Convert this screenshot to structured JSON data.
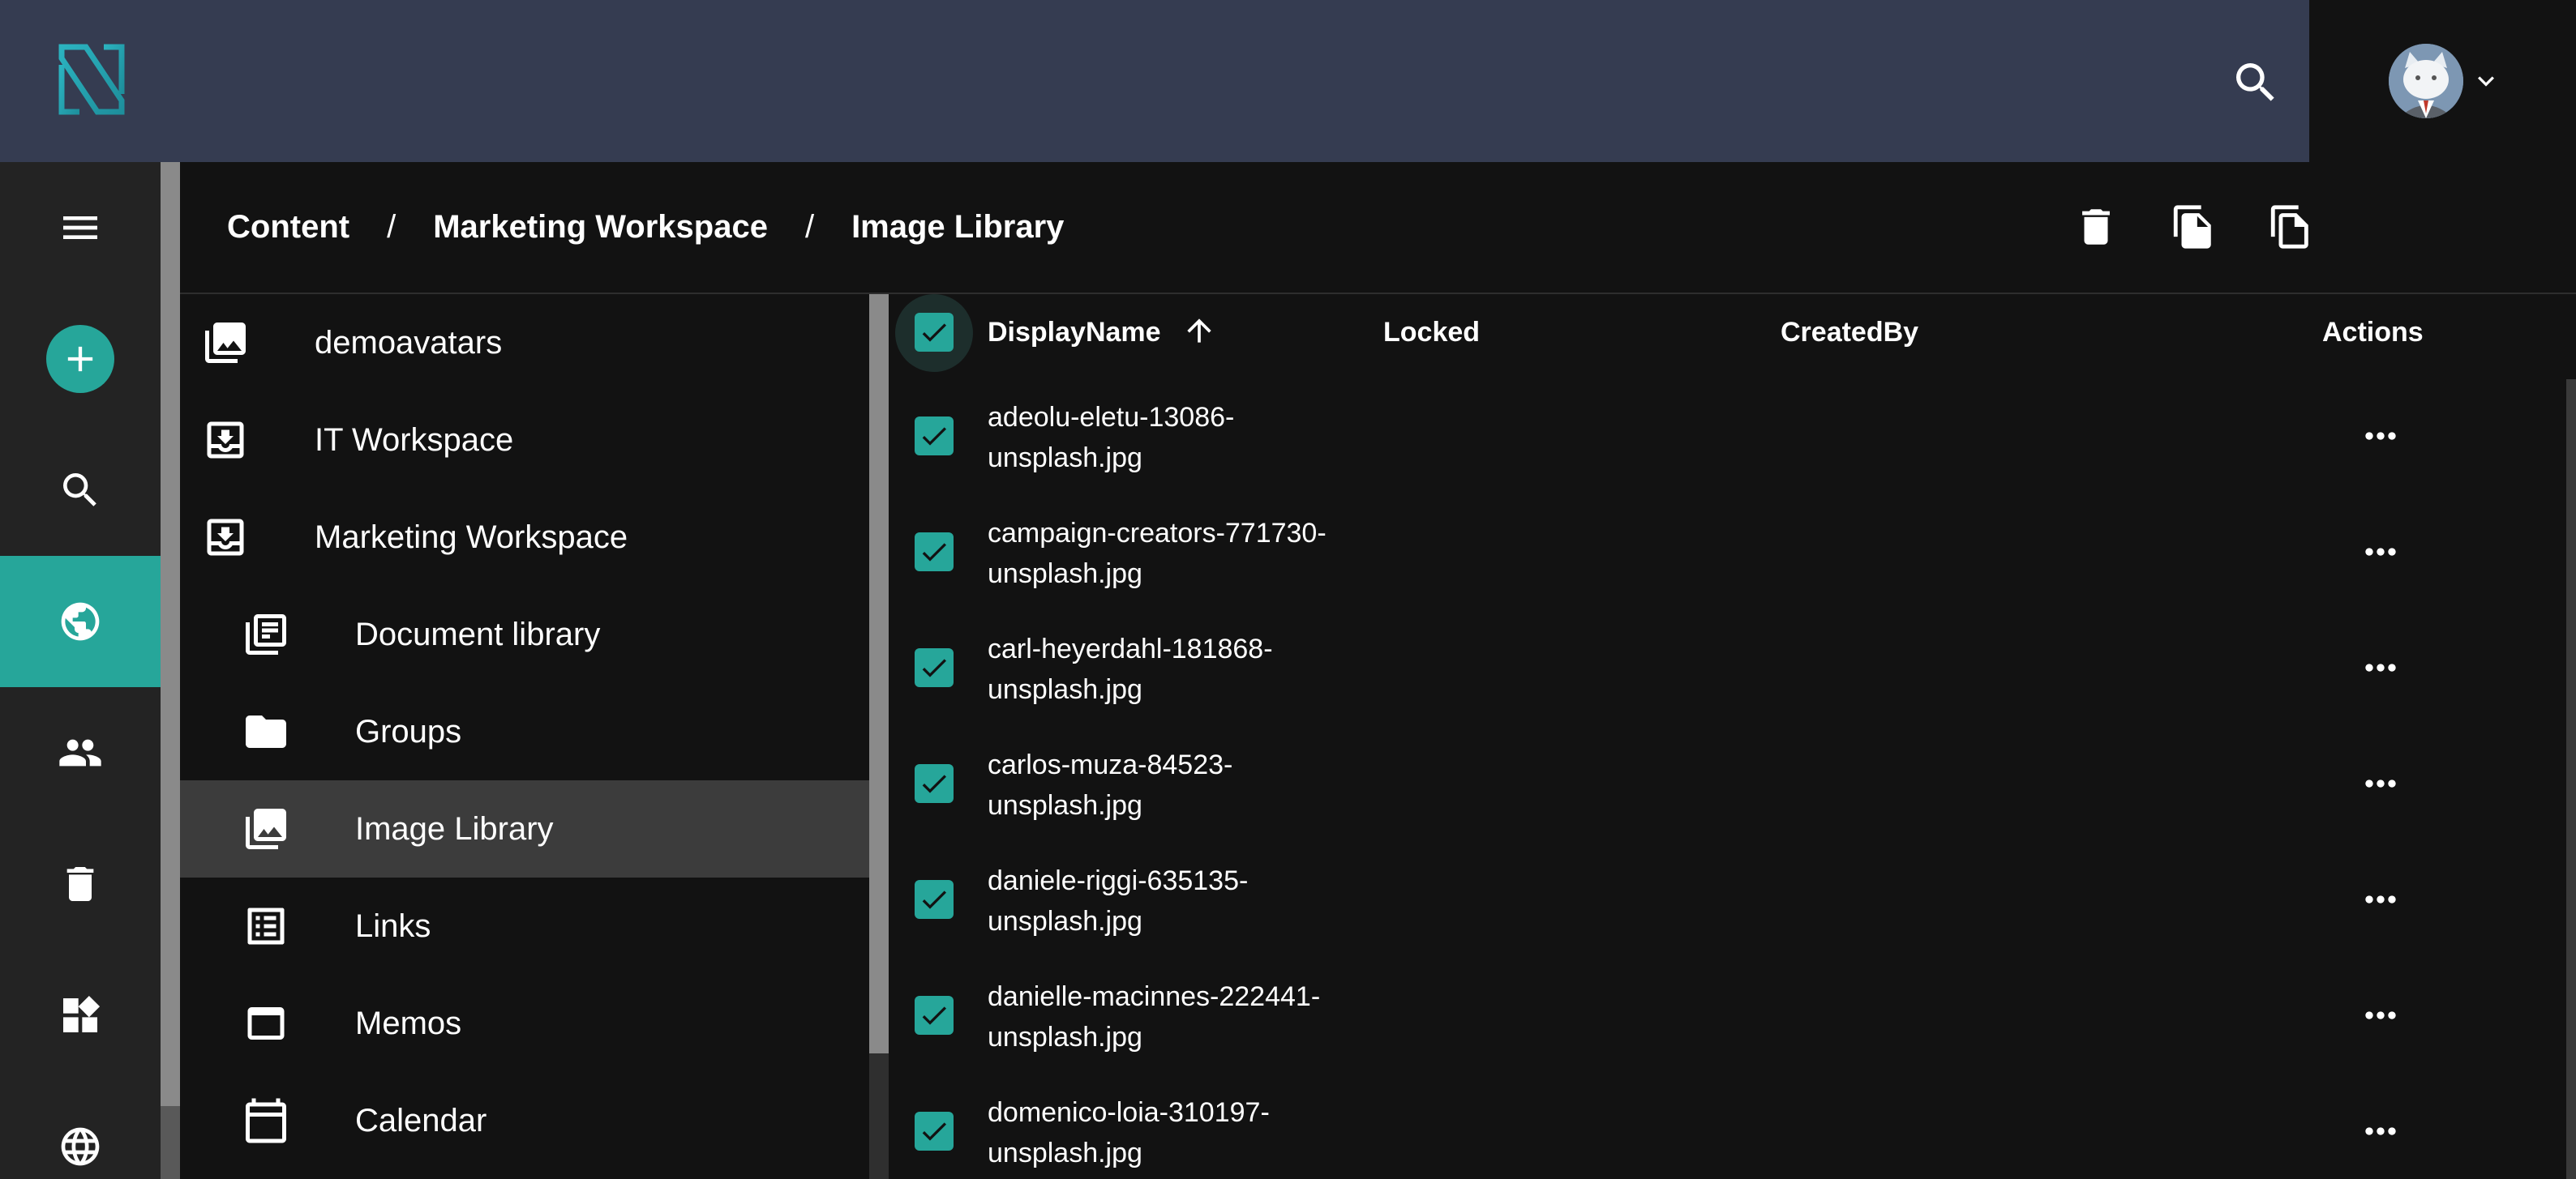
{
  "header": {
    "logo_icon": "brand-logo-icon",
    "search_icon": "search-icon",
    "avatar_icon": "user-avatar-cat",
    "menu_chevron_icon": "chevron-down-icon"
  },
  "rail": {
    "items": [
      {
        "name": "menu",
        "icon": "hamburger-menu-icon"
      },
      {
        "name": "add",
        "icon": "add-icon"
      },
      {
        "name": "search",
        "icon": "search-icon"
      },
      {
        "name": "content",
        "icon": "globe-icon",
        "active": true
      },
      {
        "name": "users",
        "icon": "people-icon"
      },
      {
        "name": "trash",
        "icon": "trash-icon"
      },
      {
        "name": "apps",
        "icon": "widgets-icon"
      },
      {
        "name": "localization",
        "icon": "language-icon"
      }
    ]
  },
  "breadcrumb": {
    "items": [
      "Content",
      "Marketing Workspace",
      "Image Library"
    ],
    "separator": "/"
  },
  "toolbar": {
    "delete_icon": "trash-icon",
    "copy_icon": "copy-file-icon",
    "move_icon": "copy-icon"
  },
  "tree": {
    "items": [
      {
        "label": "demoavatars",
        "icon": "image-library-icon",
        "level": 0
      },
      {
        "label": "IT Workspace",
        "icon": "workspace-icon",
        "level": 0
      },
      {
        "label": "Marketing Workspace",
        "icon": "workspace-icon",
        "level": 0
      },
      {
        "label": "Document library",
        "icon": "document-library-icon",
        "level": 1
      },
      {
        "label": "Groups",
        "icon": "folder-icon",
        "level": 1
      },
      {
        "label": "Image Library",
        "icon": "image-library-icon",
        "level": 1,
        "selected": true
      },
      {
        "label": "Links",
        "icon": "list-icon",
        "level": 1
      },
      {
        "label": "Memos",
        "icon": "memo-icon",
        "level": 1
      },
      {
        "label": "Calendar",
        "icon": "calendar-icon",
        "level": 1
      }
    ]
  },
  "table": {
    "columns": [
      "DisplayName",
      "Locked",
      "CreatedBy",
      "Actions"
    ],
    "sort": {
      "column": "DisplayName",
      "direction": "ascending",
      "icon": "arrow-up-icon"
    },
    "all_selected": true,
    "rows": [
      {
        "name": "adeolu-eletu-13086-unsplash.jpg",
        "line1": "adeolu-eletu-13086-",
        "line2": "unsplash.jpg",
        "selected": true
      },
      {
        "name": "campaign-creators-771730-unsplash.jpg",
        "line1": "campaign-creators-771730-",
        "line2": "unsplash.jpg",
        "selected": true
      },
      {
        "name": "carl-heyerdahl-181868-unsplash.jpg",
        "line1": "carl-heyerdahl-181868-",
        "line2": "unsplash.jpg",
        "selected": true
      },
      {
        "name": "carlos-muza-84523-unsplash.jpg",
        "line1": "carlos-muza-84523-",
        "line2": "unsplash.jpg",
        "selected": true
      },
      {
        "name": "daniele-riggi-635135-unsplash.jpg",
        "line1": "daniele-riggi-635135-",
        "line2": "unsplash.jpg",
        "selected": true
      },
      {
        "name": "danielle-macinnes-222441-unsplash.jpg",
        "line1": "danielle-macinnes-222441-",
        "line2": "unsplash.jpg",
        "selected": true
      },
      {
        "name": "domenico-loia-310197-unsplash.jpg",
        "line1": "domenico-loia-310197-",
        "line2": "unsplash.jpg",
        "selected": true
      }
    ],
    "row_actions_icon": "more-horizontal-icon"
  },
  "colors": {
    "accent": "#26a69a",
    "header": "#353c51",
    "background": "#121212",
    "rail": "#232323",
    "selected_row": "#3c3c3c"
  }
}
